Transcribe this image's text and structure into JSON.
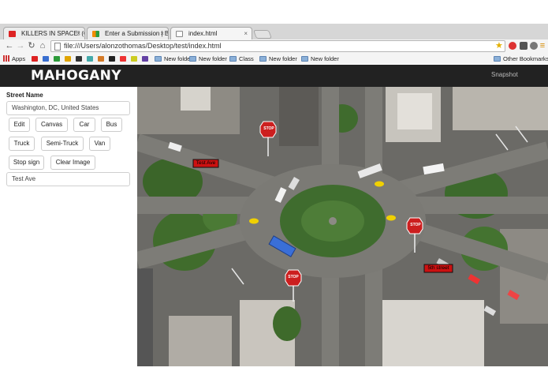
{
  "browser": {
    "tabs": [
      {
        "label": "KILLERS IN SPACE! (GMod",
        "active": false
      },
      {
        "label": "Enter a Submission | Boile",
        "active": false
      },
      {
        "label": "index.html",
        "active": true
      }
    ],
    "url": "file:///Users/alonzothomas/Desktop/test/index.html",
    "bookmarks": [
      {
        "label": "Apps"
      },
      {
        "label": "New folder"
      },
      {
        "label": "New folder"
      },
      {
        "label": "Class"
      },
      {
        "label": "New folder"
      },
      {
        "label": "New folder"
      }
    ],
    "other_bookmarks": "Other Bookmarks"
  },
  "app": {
    "brand": "MAHOGANY",
    "snapshot": "Snapshot"
  },
  "sidebar": {
    "street_name_label": "Street Name",
    "location_value": "Washington, DC, United States",
    "buttons": {
      "edit": "Edit",
      "canvas": "Canvas",
      "car": "Car",
      "bus": "Bus",
      "truck": "Truck",
      "semi_truck": "Semi-Truck",
      "van": "Van",
      "stop_sign": "Stop sign",
      "clear_image": "Clear Image"
    },
    "street_input_value": "Test Ave"
  },
  "map": {
    "labels": {
      "test_ave": "Test Ave",
      "stop_text": "STOP",
      "sth_street": "5th street"
    },
    "colors": {
      "road": "#7a7a76",
      "grass": "#3f6a2f",
      "stop_red": "#cc1f1f",
      "label_bg": "#cc1111",
      "bus_blue": "#3a6fd8"
    }
  }
}
